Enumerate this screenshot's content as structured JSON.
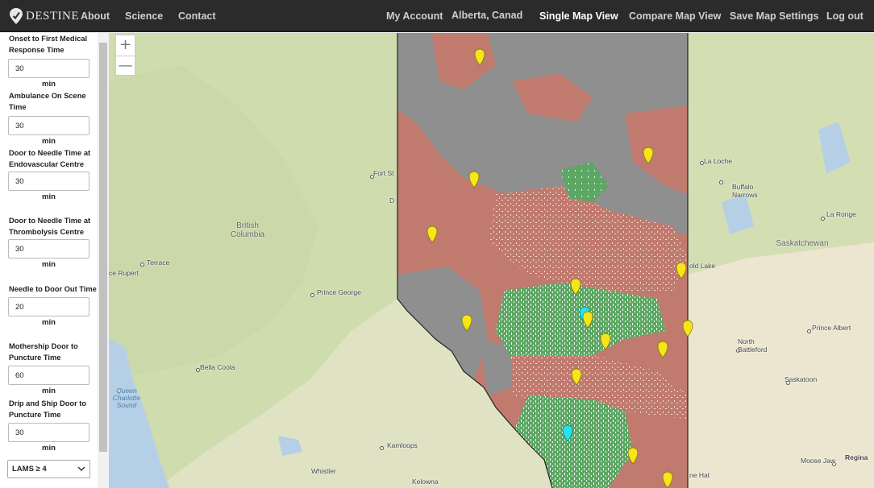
{
  "nav": {
    "brand": "DESTINE",
    "about": "About",
    "science": "Science",
    "contact": "Contact",
    "my_account": "My Account",
    "region": "Alberta, Canad",
    "single_map_view": "Single Map View",
    "compare_map_view": "Compare Map View",
    "save_map_settings": "Save Map Settings",
    "log_out": "Log out"
  },
  "sidebar": {
    "fields": [
      {
        "label": "Onset to First Medical Response Time",
        "value": "30",
        "unit": "min"
      },
      {
        "label": "Ambulance On Scene Time",
        "value": "30",
        "unit": "min"
      },
      {
        "label": "Door to Needle Time at Endovascular Centre",
        "value": "30",
        "unit": "min"
      },
      {
        "label": "Door to Needle Time at Thrombolysis Centre",
        "value": "30",
        "unit": "min"
      },
      {
        "label": "Needle to Door Out Time",
        "value": "20",
        "unit": "min"
      },
      {
        "label": "Mothership Door to Puncture Time",
        "value": "60",
        "unit": "min"
      },
      {
        "label": "Drip and Ship Door to Puncture Time",
        "value": "30",
        "unit": "min"
      }
    ],
    "lams_select": "LAMS ≥ 4"
  },
  "map": {
    "zoom_in": "+",
    "zoom_out": "—",
    "provinces": {
      "bc": "British Columbia",
      "sk": "Saskatchewan"
    },
    "water": {
      "qcs": "Queen Charlotte Sound"
    },
    "places": {
      "terrace": "Terrace",
      "prince_rupert": "ce Rupert",
      "prince_george": "Prince George",
      "bella_coola": "Bella Coola",
      "kamloops": "Kamloops",
      "kelowna": "Kelowna",
      "whistler": "Whistler",
      "fort_st": "Fort St",
      "d": "D",
      "la_loche": "La Loche",
      "buffalo_narrows": "Buffalo Narrows",
      "la_ronge": "La Ronge",
      "cold_lake": "old Lake",
      "prince_albert": "Prince Albert",
      "north_battleford": "North Battleford",
      "saskatoon": "Saskatoon",
      "moose_jaw": "Moose Jaw",
      "regina": "Regina",
      "medicine_hat": "ne Hat"
    },
    "colors": {
      "base": "#dfe3c3",
      "forest": "#cfdcae",
      "water": "#b5d0e6",
      "grey_zone": "#8f8f8f",
      "red_zone": "#c07a6e",
      "green_zone": "#5da764",
      "marker_yellow": "#f5e51a",
      "marker_cyan": "#27e3ef"
    }
  }
}
